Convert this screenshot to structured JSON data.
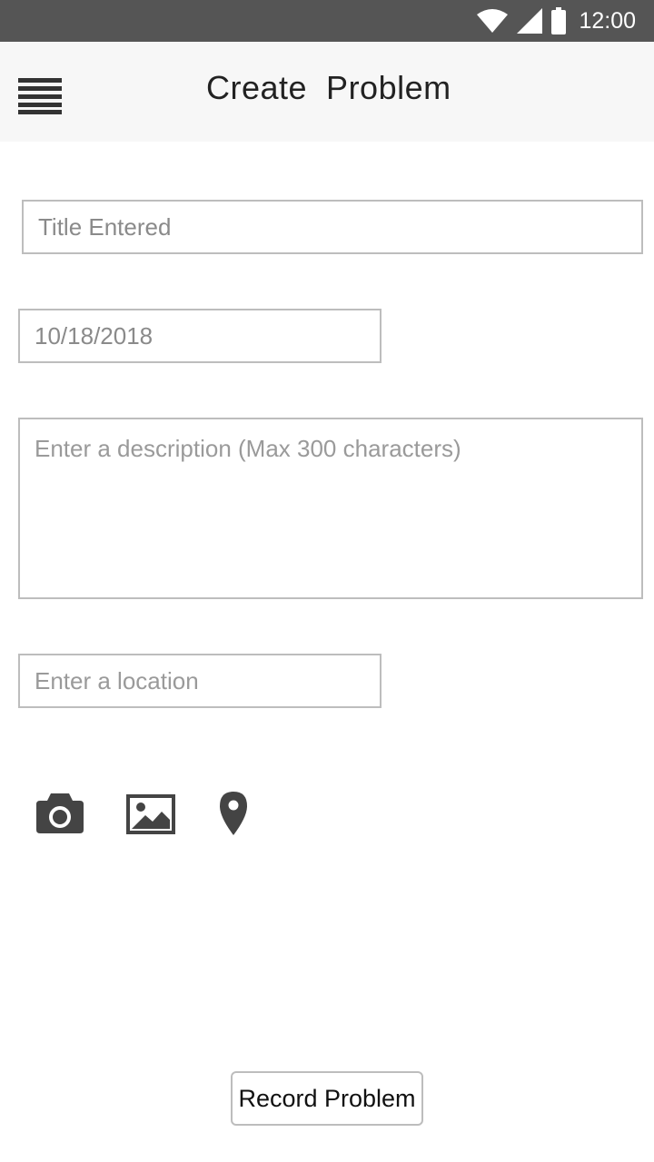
{
  "status_bar": {
    "time": "12:00",
    "icons": [
      "wifi-icon",
      "signal-icon",
      "battery-icon"
    ]
  },
  "app_bar": {
    "menu_icon": "menu-icon",
    "title": "Create  Problem"
  },
  "form": {
    "title_value": "Title Entered",
    "date_value": "10/18/2018",
    "description_placeholder": "Enter a description (Max 300 characters)",
    "location_placeholder": "Enter a location"
  },
  "actions": {
    "icons": [
      "camera-icon",
      "image-icon",
      "location-pin-icon"
    ]
  },
  "submit": {
    "label": "Record Problem"
  },
  "colors": {
    "status_bar_bg": "#555555",
    "app_bar_bg": "#f7f7f7",
    "field_border": "#bdbdbd",
    "icon": "#444444"
  }
}
